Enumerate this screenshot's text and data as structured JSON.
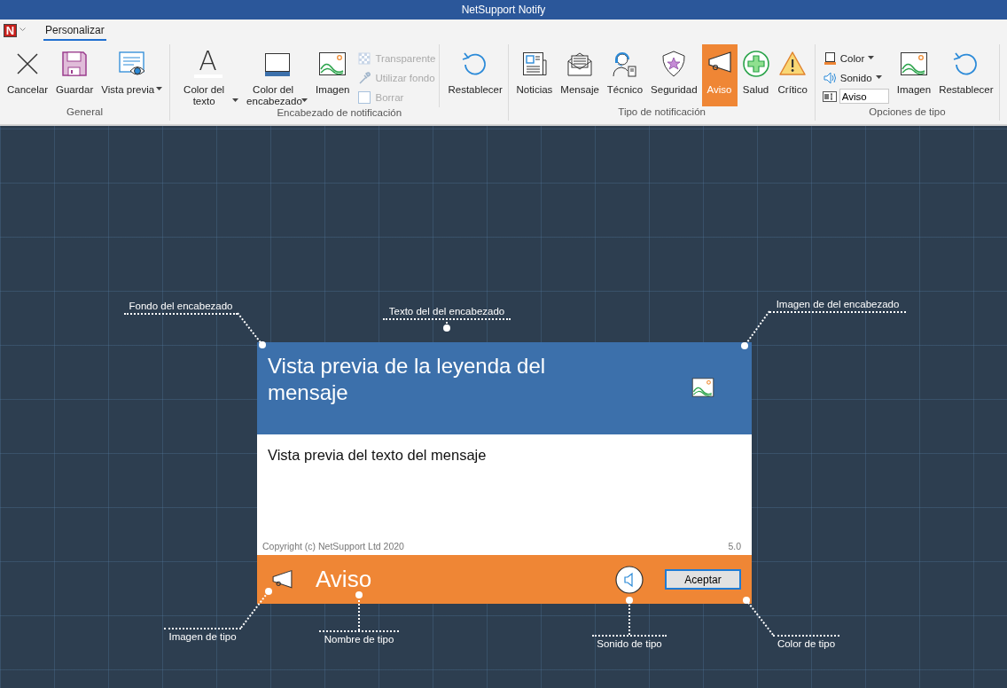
{
  "window": {
    "title": "NetSupport Notify"
  },
  "app_menu": {
    "logo": "N"
  },
  "tabs": [
    {
      "label": "Personalizar",
      "selected": true
    }
  ],
  "ribbon": {
    "groups": [
      {
        "label": "General",
        "items": [
          {
            "kind": "large",
            "label": "Cancelar"
          },
          {
            "kind": "large",
            "label": "Guardar"
          },
          {
            "kind": "large",
            "label": "Vista previa",
            "dropdown": true
          }
        ]
      },
      {
        "label": "Encabezado de notificación",
        "items": [
          {
            "kind": "large",
            "label": "Color del texto",
            "dropdown": true,
            "glyph": "A"
          },
          {
            "kind": "large",
            "label": "Color del encabezado",
            "dropdown": true
          },
          {
            "kind": "large",
            "label": "Imagen"
          },
          {
            "kind": "stack",
            "items": [
              {
                "kind": "button",
                "label": "Transparente",
                "disabled": true
              },
              {
                "kind": "button",
                "label": "Utilizar fondo",
                "disabled": true
              },
              {
                "kind": "button",
                "label": "Borrar",
                "disabled": true
              }
            ]
          },
          {
            "kind": "large",
            "label": "Restablecer"
          }
        ]
      },
      {
        "label": "Tipo de notificación",
        "items": [
          {
            "kind": "large",
            "label": "Noticias",
            "selected": false
          },
          {
            "kind": "large",
            "label": "Mensaje",
            "selected": false
          },
          {
            "kind": "large",
            "label": "Técnico",
            "selected": false
          },
          {
            "kind": "large",
            "label": "Seguridad",
            "selected": false
          },
          {
            "kind": "large",
            "label": "Aviso",
            "selected": true
          },
          {
            "kind": "large",
            "label": "Salud",
            "selected": false
          },
          {
            "kind": "large",
            "label": "Crítico",
            "selected": false
          }
        ]
      },
      {
        "label": "Opciones de tipo",
        "items": [
          {
            "kind": "stack",
            "items": [
              {
                "kind": "button",
                "label": "Color",
                "dropdown": true,
                "disabled": false
              },
              {
                "kind": "button",
                "label": "Sonido",
                "dropdown": true,
                "disabled": false
              },
              {
                "kind": "field",
                "value": "Aviso"
              }
            ]
          },
          {
            "kind": "large",
            "label": "Imagen"
          },
          {
            "kind": "large",
            "label": "Restablecer"
          }
        ]
      }
    ]
  },
  "preview": {
    "header_text": "Vista previa de la leyenda del mensaje",
    "body_text": "Vista previa del texto del mensaje",
    "copyright": "Copyright (c) NetSupport Ltd 2020",
    "version": "5.0",
    "type_name": "Aviso",
    "button": "Aceptar"
  },
  "annotations": [
    {
      "label": "Fondo del encabezado"
    },
    {
      "label": "Texto del del encabezado"
    },
    {
      "label": "Imagen de del encabezado"
    },
    {
      "label": "Imagen de tipo"
    },
    {
      "label": "Nombre de tipo"
    },
    {
      "label": "Sonido de tipo"
    },
    {
      "label": "Color de tipo"
    }
  ]
}
